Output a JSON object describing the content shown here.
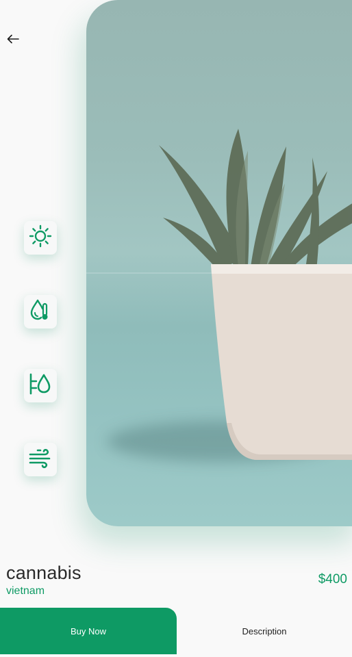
{
  "header": {
    "back_icon": "arrow-left-icon"
  },
  "hero": {
    "image_description_icon": "potted-plant-image"
  },
  "care_icons": [
    {
      "name": "sun-icon"
    },
    {
      "name": "humidity-temperature-icon"
    },
    {
      "name": "watering-icon"
    },
    {
      "name": "wind-icon"
    }
  ],
  "product": {
    "name": "cannabis",
    "origin": "vietnam",
    "price": "$400"
  },
  "actions": {
    "buy_label": "Buy Now",
    "description_label": "Description"
  },
  "colors": {
    "accent": "#0e9a64",
    "background": "#f9f9f9",
    "text": "#2a2a2a"
  }
}
